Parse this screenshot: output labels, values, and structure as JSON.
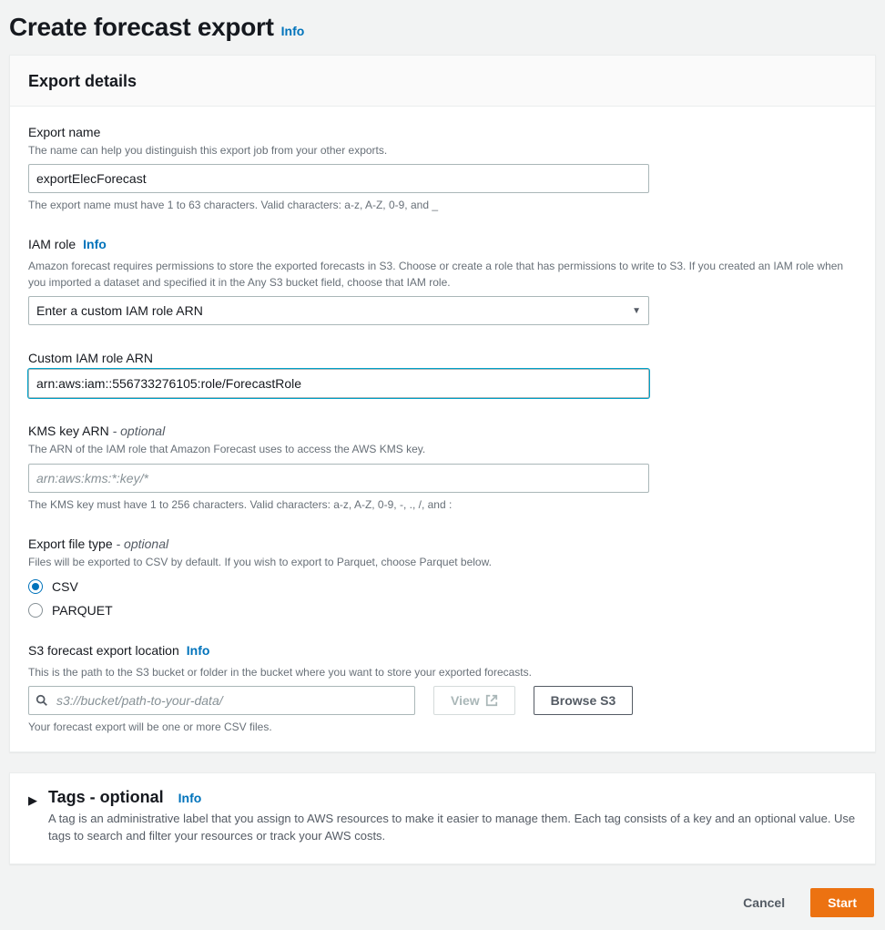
{
  "page": {
    "title": "Create forecast export",
    "info": "Info"
  },
  "panel": {
    "title": "Export details"
  },
  "exportName": {
    "label": "Export name",
    "hint": "The name can help you distinguish this export job from your other exports.",
    "value": "exportElecForecast",
    "constraint": "The export name must have 1 to 63 characters. Valid characters: a-z, A-Z, 0-9, and _"
  },
  "iamRole": {
    "label": "IAM role",
    "info": "Info",
    "hint": "Amazon forecast requires permissions to store the exported forecasts in S3. Choose or create a role that has permissions to write to S3. If you created an IAM role when you imported a dataset and specified it in the Any S3 bucket field, choose that IAM role.",
    "selected": "Enter a custom IAM role ARN"
  },
  "customArn": {
    "label": "Custom IAM role ARN",
    "value": "arn:aws:iam::556733276105:role/ForecastRole"
  },
  "kms": {
    "label": "KMS key ARN",
    "optional": "- optional",
    "hint": "The ARN of the IAM role that Amazon Forecast uses to access the AWS KMS key.",
    "placeholder": "arn:aws:kms:*:key/*",
    "constraint": "The KMS key must have 1 to 256 characters. Valid characters: a-z, A-Z, 0-9, -, ., /, and :"
  },
  "fileType": {
    "label": "Export file type",
    "optional": "- optional",
    "hint": "Files will be exported to CSV by default. If you wish to export to Parquet, choose Parquet below.",
    "options": [
      "CSV",
      "PARQUET"
    ],
    "selected": "CSV"
  },
  "s3": {
    "label": "S3 forecast export location",
    "info": "Info",
    "hint": "This is the path to the S3 bucket or folder in the bucket where you want to store your exported forecasts.",
    "placeholder": "s3://bucket/path-to-your-data/",
    "viewLabel": "View",
    "browseLabel": "Browse S3",
    "constraint": "Your forecast export will be one or more CSV files."
  },
  "tags": {
    "title": "Tags - optional",
    "info": "Info",
    "desc": "A tag is an administrative label that you assign to AWS resources to make it easier to manage them. Each tag consists of a key and an optional value. Use tags to search and filter your resources or track your AWS costs."
  },
  "footer": {
    "cancel": "Cancel",
    "start": "Start"
  }
}
